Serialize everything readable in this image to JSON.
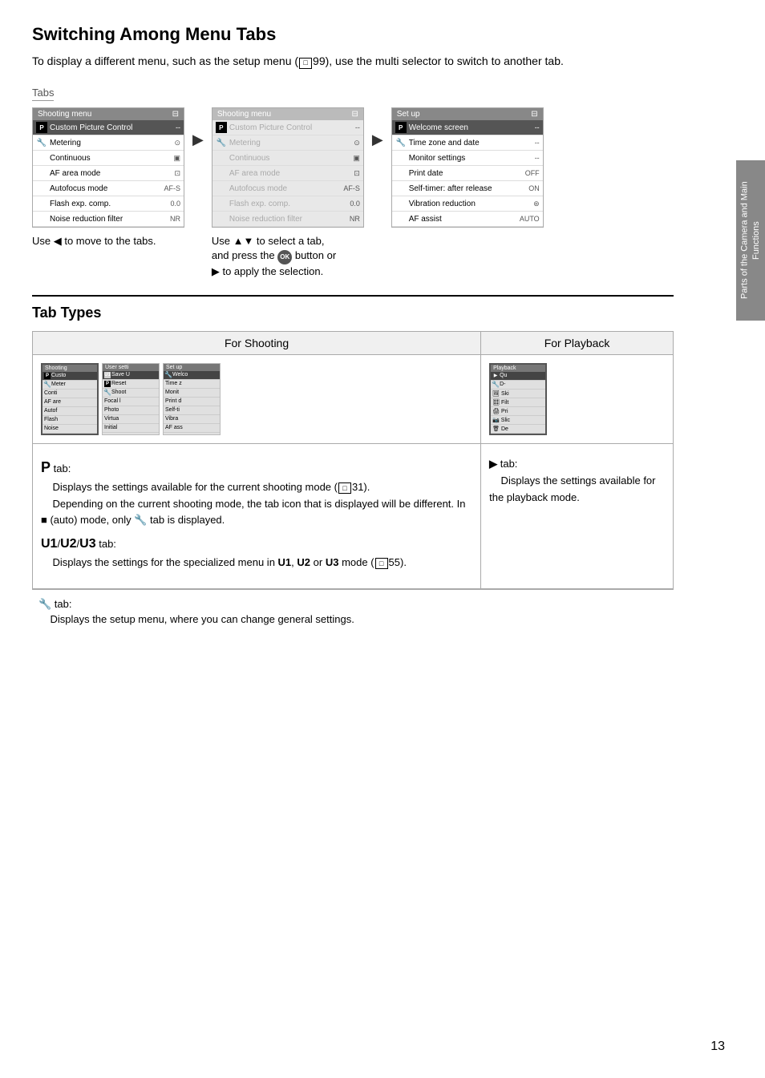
{
  "page": {
    "title": "Switching Among Menu Tabs",
    "intro": "To display a different menu, such as the setup menu (□99), use the multi selector to switch to another tab.",
    "tabs_label": "Tabs",
    "page_number": "13",
    "side_tab_text": "Parts of the Camera and Main Functions"
  },
  "menu_screenshots": {
    "caption_left": "Use ◄ to move to the tabs.",
    "caption_middle": "Use ▲▼ to select a tab, and press the ⒪ button or ▶ to apply the selection."
  },
  "left_menu": {
    "header": "Shooting menu",
    "rows": [
      {
        "label": "Custom Picture Control",
        "val": "--",
        "selected": true,
        "icon": "P"
      },
      {
        "label": "Metering",
        "val": "•",
        "icon": "wrench"
      },
      {
        "label": "Continuous",
        "val": "□"
      },
      {
        "label": "AF area mode",
        "val": "•"
      },
      {
        "label": "Autofocus mode",
        "val": "AF-S"
      },
      {
        "label": "Flash exp. comp.",
        "val": "0.0"
      },
      {
        "label": "Noise reduction filter",
        "val": "NR"
      }
    ]
  },
  "middle_menu": {
    "header": "Shooting menu",
    "rows": [
      {
        "label": "Custom Picture Control",
        "val": "--",
        "dimmed": true,
        "icon": "P"
      },
      {
        "label": "Metering",
        "val": "•",
        "dimmed": true,
        "icon": "wrench"
      },
      {
        "label": "Continuous",
        "val": "□",
        "dimmed": true
      },
      {
        "label": "AF area mode",
        "val": "•",
        "dimmed": true
      },
      {
        "label": "Autofocus mode",
        "val": "AF-S",
        "dimmed": true
      },
      {
        "label": "Flash exp. comp.",
        "val": "0.0",
        "dimmed": true
      },
      {
        "label": "Noise reduction filter",
        "val": "NR",
        "dimmed": true
      }
    ]
  },
  "right_menu": {
    "header": "Set up",
    "rows": [
      {
        "label": "Welcome screen",
        "val": "--",
        "selected": true,
        "icon": "P"
      },
      {
        "label": "Time zone and date",
        "val": "--",
        "icon": "wrench"
      },
      {
        "label": "Monitor settings",
        "val": "--"
      },
      {
        "label": "Print date",
        "val": "OFF"
      },
      {
        "label": "Self-timer: after release",
        "val": "ON"
      },
      {
        "label": "Vibration reduction",
        "val": "⒥"
      },
      {
        "label": "AF assist",
        "val": "AUTO"
      }
    ]
  },
  "tab_types": {
    "section_title": "Tab Types",
    "col_shooting": "For Shooting",
    "col_playback": "For Playback",
    "mini_menus": {
      "shooting": {
        "header": "Shooting",
        "rows": [
          "Custo",
          "Meter",
          "Conti",
          "AF are",
          "Autof",
          "Flash",
          "Noise"
        ]
      },
      "user_setti": {
        "header": "User setti",
        "rows": [
          "Save U",
          "Reset",
          "Shoot",
          "Focal l",
          "Photo",
          "Virtua",
          "Initial"
        ]
      },
      "setup": {
        "header": "Set up",
        "rows": [
          "Welco",
          "Time z",
          "Monit",
          "Print d",
          "Self-ti",
          "Vibra",
          "AF ass"
        ]
      },
      "playback": {
        "header": "Playback",
        "rows": [
          "Qu",
          "D-",
          "Ski",
          "Filt",
          "Pri",
          "Slic",
          "De"
        ]
      }
    },
    "p_tab_desc": "P tab:\n    Displays the settings available for the current shooting mode (□31).\n    Depending on the current shooting mode, the tab icon that is displayed will be different. In ■ (auto) mode, only ♀ tab is displayed.",
    "u_tab_label": "U1/U2/U3 tab:",
    "u_tab_desc": "Displays the settings for the specialized menu in U1, U2 or U3 mode (□55).",
    "playback_tab_label": "► tab:",
    "playback_tab_desc": "Displays the settings available for the playback mode.",
    "setup_tab_label": "♀ tab:",
    "setup_tab_desc": "Displays the setup menu, where you can change general settings."
  }
}
